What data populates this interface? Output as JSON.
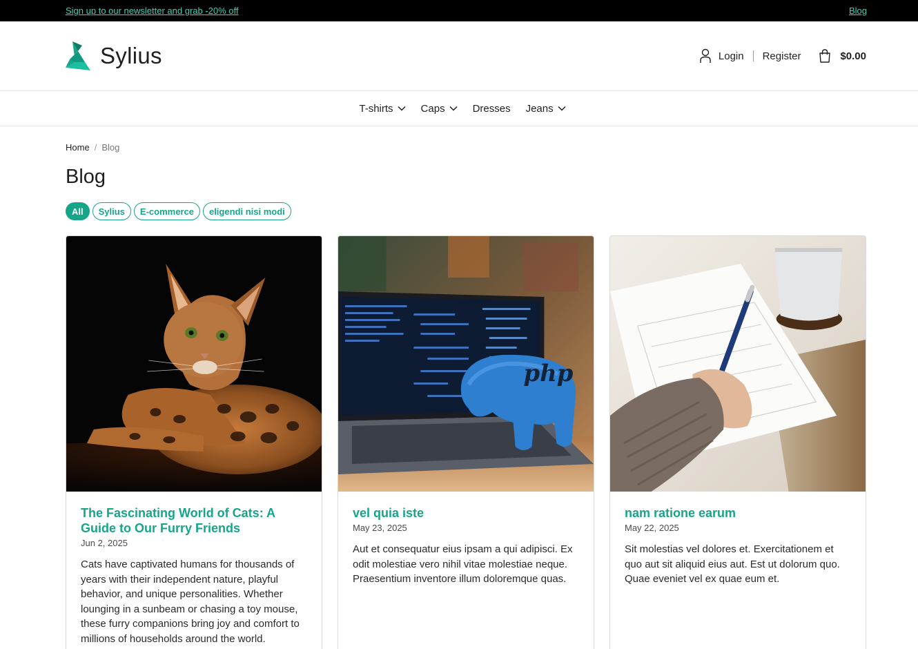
{
  "topbar": {
    "newsletter_link": "Sign up to our newsletter and grab -20% off",
    "blog_link": "Blog"
  },
  "header": {
    "logo_text": "Sylius",
    "login": "Login",
    "register": "Register",
    "cart_total": "$0.00"
  },
  "nav": {
    "items": [
      {
        "label": "T-shirts",
        "has_dropdown": true
      },
      {
        "label": "Caps",
        "has_dropdown": true
      },
      {
        "label": "Dresses",
        "has_dropdown": false
      },
      {
        "label": "Jeans",
        "has_dropdown": true
      }
    ]
  },
  "breadcrumb": {
    "home": "Home",
    "separator": "/",
    "current": "Blog"
  },
  "page": {
    "title": "Blog"
  },
  "filters": [
    {
      "label": "All",
      "active": true
    },
    {
      "label": "Sylius",
      "active": false
    },
    {
      "label": "E-commerce",
      "active": false
    },
    {
      "label": "eligendi nisi modi",
      "active": false
    }
  ],
  "posts": [
    {
      "image": "bengal-cat-photo",
      "title": "The Fascinating World of Cats: A Guide to Our Furry Friends",
      "date": "Jun 2, 2025",
      "excerpt": "Cats have captivated humans for thousands of years with their independent nature, playful behavior, and unique personalities. Whether lounging in a sunbeam or chasing a toy mouse, these furry companions bring joy and comfort to millions of households around the world."
    },
    {
      "image": "laptop-php-elephant-photo",
      "title": "vel quia iste",
      "date": "May 23, 2025",
      "excerpt": "Aut et consequatur eius ipsam a qui adipisci. Ex odit molestiae vero nihil vitae molestiae neque. Praesentium inventore illum doloremque quas."
    },
    {
      "image": "writing-desk-coffee-photo",
      "title": "nam ratione earum",
      "date": "May 22, 2025",
      "excerpt": "Sit molestias vel dolores et. Exercitationem et quo aut sit aliquid eius aut. Est ut dolorum quo. Quae eveniet vel ex quae eum et."
    }
  ],
  "colors": {
    "brand": "#17a589",
    "topbar_bg": "#000000",
    "topbar_link": "#3bd3b4"
  }
}
